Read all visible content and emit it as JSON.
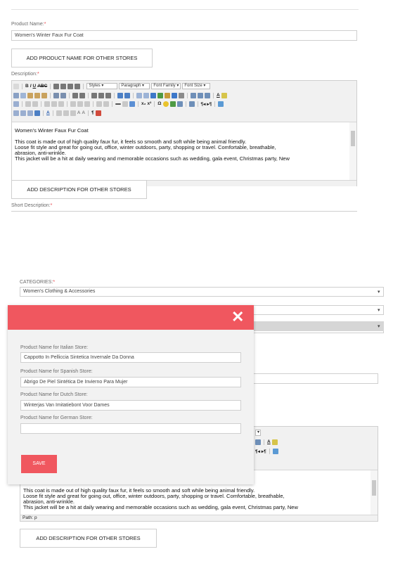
{
  "form": {
    "product_name_label": "Product Name:",
    "required_mark": "*",
    "product_name_value": "Women's Winter Faux Fur Coat",
    "add_product_name_button": "ADD PRODUCT NAME FOR OTHER STORES",
    "description_label": "Description:",
    "add_description_button": "ADD DESCRIPTION FOR OTHER STORES",
    "short_description_label": "Short Description:",
    "categories_label": "CATEGORIES:",
    "category_value": "Women's Clothing & Accessories"
  },
  "editor": {
    "styles_select": "Styles",
    "paragraph_select": "Paragraph",
    "font_family_select": "Font Family",
    "font_size_select": "Font Size",
    "title_line": "Women's Winter Faux Fur Coat",
    "body_line_1": "This coat is made out of high quality faux fur, it feels so smooth and soft while being animal friendly.",
    "body_line_2": "Loose fit style and great for going out, office, winter outdoors, party, shopping or travel. Comfortable, breathable,",
    "body_line_3": "abrasion, anti-wrinkle.",
    "body_line_4": "This jacket will be a hit at daily wearing and memorable occasions such as wedding, gala event, Christmas party, New",
    "path_text": "Path: p"
  },
  "modal": {
    "close_symbol": "✕",
    "italian_label": "Product Name for Italian Store:",
    "italian_value": "Cappotto In Pelliccia Sintetica Invernale Da Donna",
    "spanish_label": "Product Name for Spanish Store:",
    "spanish_value": "Abrigo De Piel Sintética De Invierno Para Mujer",
    "dutch_label": "Product Name for Dutch Store:",
    "dutch_value": "Winterjas Van Imitatiebont Voor Dames",
    "german_label": "Product Name for German Store:",
    "german_value": "",
    "save_button": "SAVE"
  },
  "colors": {
    "accent": "#f0575f",
    "required": "#e8474e"
  }
}
